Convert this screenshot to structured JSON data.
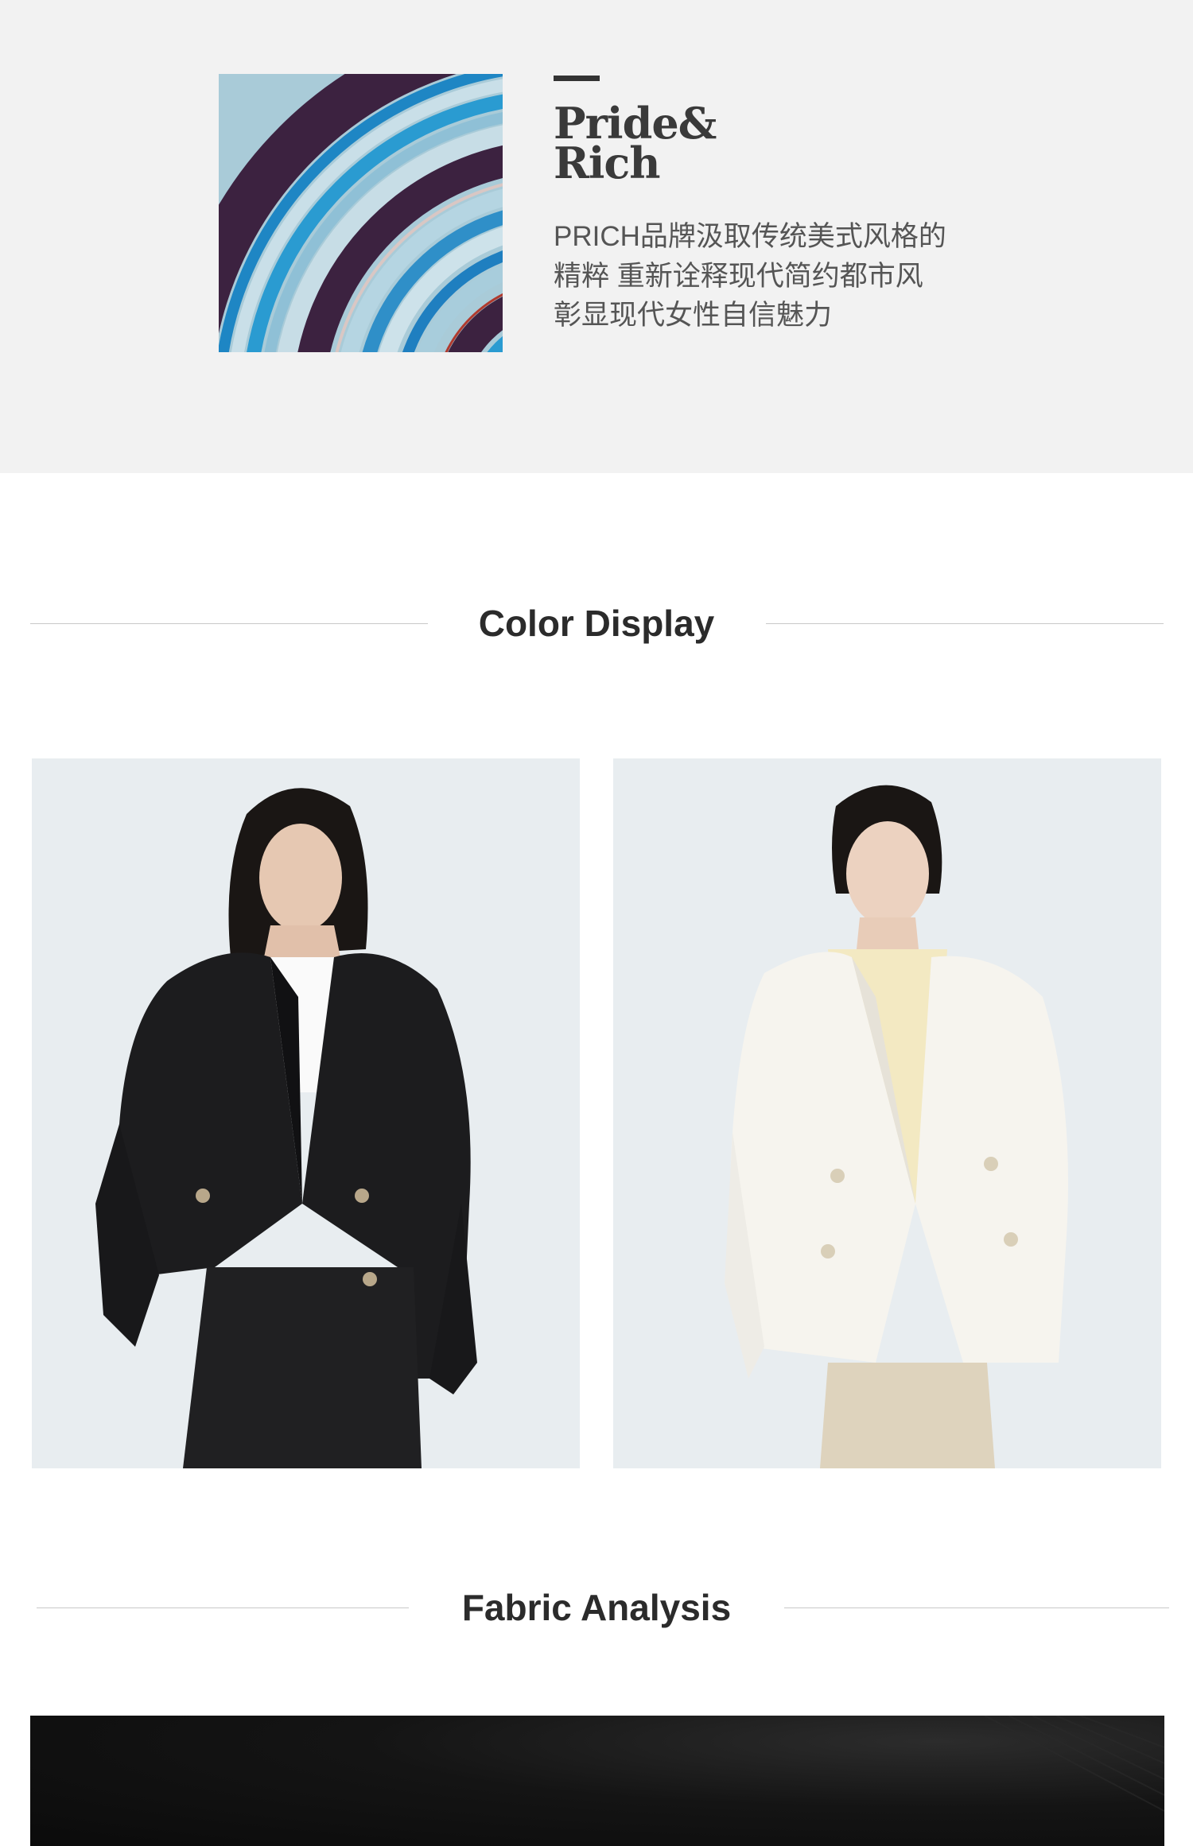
{
  "brand": {
    "name_line1": "Pride&",
    "name_line2": "Rich",
    "tagline": [
      "PRICH品牌汲取传统美式风格的",
      "精粹  重新诠释现代简约都市风",
      "彰显现代女性自信魅力"
    ]
  },
  "sections": {
    "color_display": "Color Display",
    "fabric_analysis": "Fabric Analysis"
  },
  "products": [
    {
      "color": "black",
      "swatch": "#1c1c1e"
    },
    {
      "color": "white",
      "swatch": "#f4f2ec"
    }
  ],
  "colors": {
    "hero_bg": "#f2f2f2",
    "text_dark": "#2b2b2b",
    "rule": "#c8c8c8"
  }
}
